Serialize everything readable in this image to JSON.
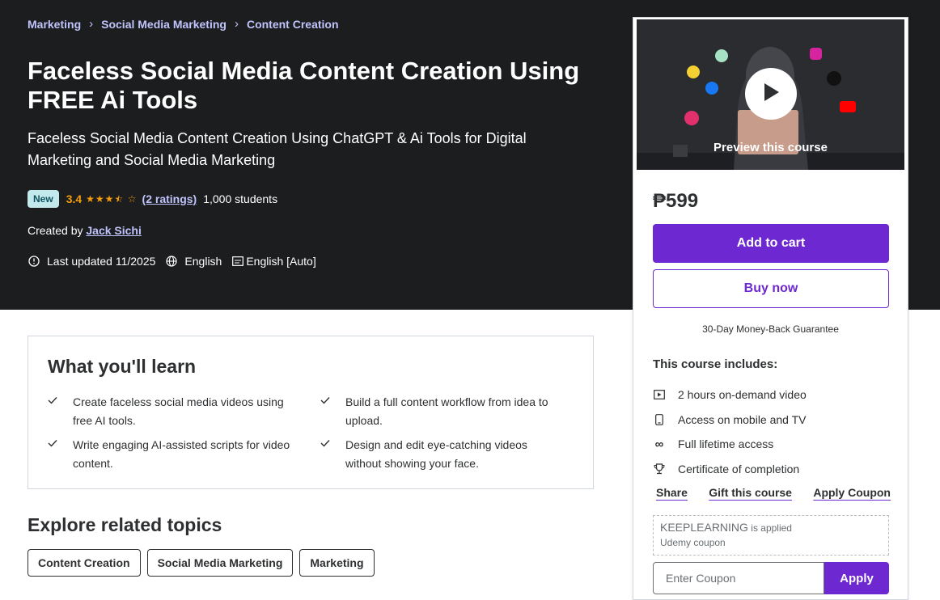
{
  "breadcrumb": [
    "Marketing",
    "Social Media Marketing",
    "Content Creation"
  ],
  "course": {
    "title": "Faceless Social Media Content Creation Using FREE Ai Tools",
    "subtitle": "Faceless Social Media Content Creation Using ChatGPT & Ai Tools for Digital Marketing and Social Media Marketing",
    "badge": "New",
    "rating": "3.4",
    "rating_value": 3.4,
    "ratings_link": "(2 ratings)",
    "students": "1,000 students",
    "created_by_label": "Created by",
    "author": "Jack Sichi",
    "last_updated": "Last updated 11/2025",
    "language": "English",
    "captions": "English [Auto]"
  },
  "sidebar": {
    "preview_label": "Preview this course",
    "price": "₱599",
    "add_to_cart": "Add to cart",
    "buy_now": "Buy now",
    "guarantee": "30-Day Money-Back Guarantee",
    "includes_title": "This course includes:",
    "includes": [
      {
        "icon": "video-icon",
        "label": "2 hours on-demand video"
      },
      {
        "icon": "mobile-icon",
        "label": "Access on mobile and TV"
      },
      {
        "icon": "infinity-icon",
        "label": "Full lifetime access"
      },
      {
        "icon": "trophy-icon",
        "label": "Certificate of completion"
      }
    ],
    "share": "Share",
    "gift": "Gift this course",
    "apply_coupon": "Apply Coupon",
    "coupon_code": "KEEPLEARNING",
    "coupon_applied_text": " is applied",
    "coupon_sub": "Udemy coupon",
    "coupon_placeholder": "Enter Coupon",
    "apply_button": "Apply"
  },
  "learn": {
    "title": "What you'll learn",
    "items": [
      "Create faceless social media videos using free AI tools.",
      "Build a full content workflow from idea to upload.",
      "Write engaging AI-assisted scripts for video content.",
      "Design and edit eye-catching videos without showing your face."
    ]
  },
  "explore": {
    "title": "Explore related topics",
    "topics": [
      "Content Creation",
      "Social Media Marketing",
      "Marketing"
    ]
  },
  "colors": {
    "hero_bg": "#1c1d1f",
    "accent": "#6d28d2",
    "link": "#c0c4fc",
    "rating": "#f69c08",
    "badge_bg": "#c2e9eb"
  }
}
